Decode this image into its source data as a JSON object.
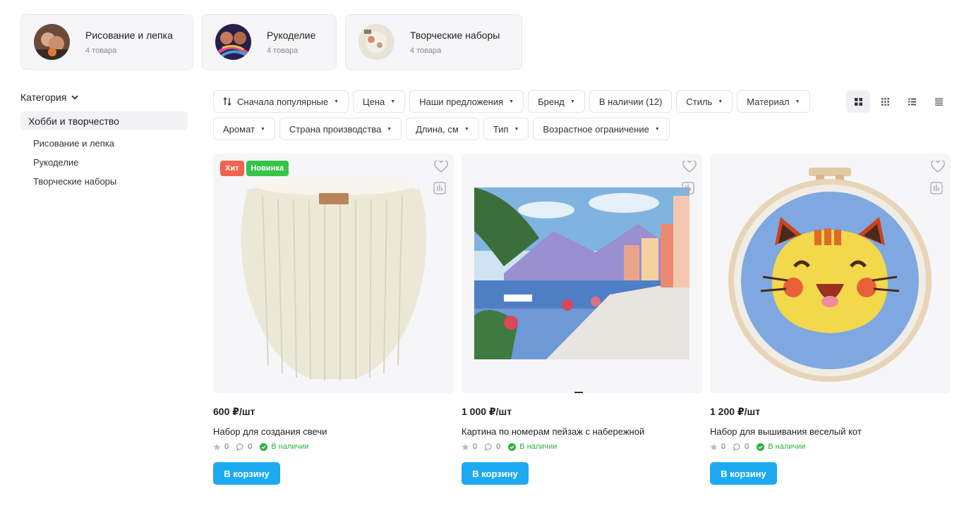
{
  "top_categories": [
    {
      "title": "Рисование и лепка",
      "count": "4 товара"
    },
    {
      "title": "Рукоделие",
      "count": "4 товара"
    },
    {
      "title": "Творческие наборы",
      "count": "4 товара"
    }
  ],
  "sidebar": {
    "heading": "Категория",
    "active": "Хобби и творчество",
    "items": [
      "Рисование и лепка",
      "Рукоделие",
      "Творческие наборы"
    ]
  },
  "filters": [
    "Сначала популярные",
    "Цена",
    "Наши предложения",
    "Бренд",
    "В наличии (12)",
    "Стиль",
    "Материал",
    "Аромат",
    "Страна производства",
    "Длина, см",
    "Тип",
    "Возрастное ограничение"
  ],
  "view_modes": [
    "grid-large-icon",
    "grid-small-icon",
    "list-icon",
    "list-compact-icon"
  ],
  "products": [
    {
      "price": "600 ₽/шт",
      "name": "Набор для создания свечи",
      "rating": "0",
      "reviews": "0",
      "stock": "В наличии",
      "button": "В корзину",
      "badges": [
        "Хит",
        "Новинка"
      ]
    },
    {
      "price": "1 000 ₽/шт",
      "name": "Картина по номерам пейзаж с набережной",
      "rating": "0",
      "reviews": "0",
      "stock": "В наличии",
      "button": "В корзину",
      "badges": []
    },
    {
      "price": "1 200 ₽/шт",
      "name": "Набор для вышивания веселый кот",
      "rating": "0",
      "reviews": "0",
      "stock": "В наличии",
      "button": "В корзину",
      "badges": []
    }
  ],
  "colors": {
    "accent": "#1eaaf1",
    "hit": "#f0624f",
    "new": "#37c24a",
    "in_stock": "#2db23f"
  }
}
